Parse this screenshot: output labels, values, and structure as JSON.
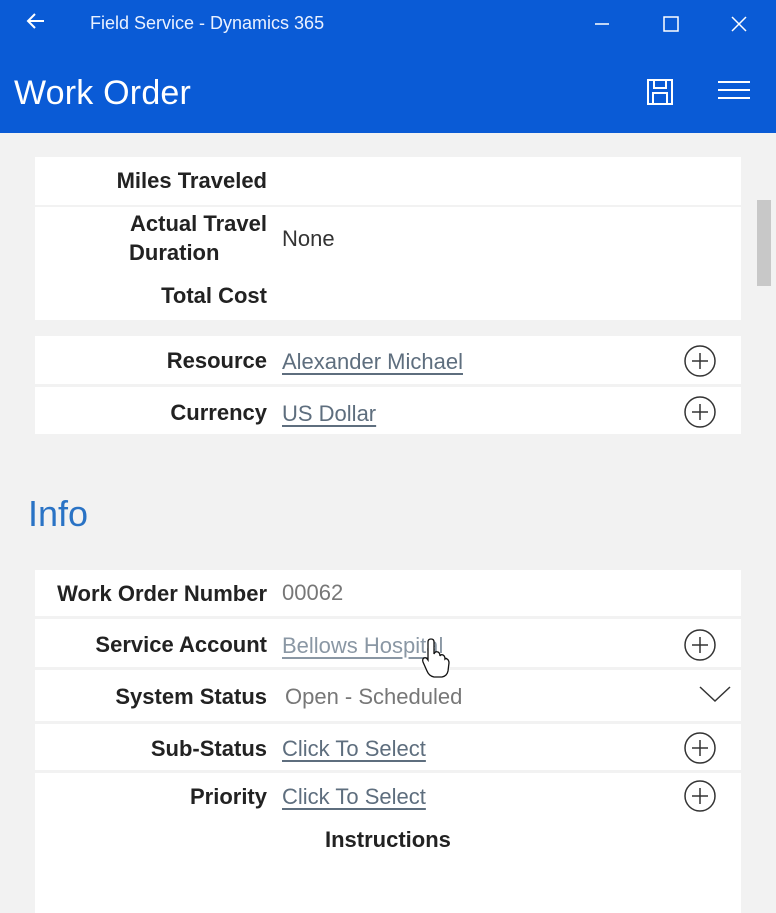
{
  "window": {
    "app_title": "Field Service - Dynamics 365"
  },
  "header": {
    "title": "Work Order"
  },
  "travel": {
    "miles_label": "Miles Traveled",
    "miles_value": "",
    "duration_label_line1": "Actual Travel",
    "duration_label_line2": "Duration",
    "duration_value": "None",
    "total_cost_label": "Total Cost",
    "total_cost_value": ""
  },
  "lookups": {
    "resource_label": "Resource",
    "resource_value": "Alexander Michael",
    "currency_label": "Currency",
    "currency_value": "US Dollar"
  },
  "info": {
    "section_title": "Info",
    "work_order_number_label": "Work Order Number",
    "work_order_number_value": "00062",
    "service_account_label": "Service Account",
    "service_account_value": "Bellows Hospital",
    "system_status_label": "System Status",
    "system_status_value": "Open - Scheduled",
    "sub_status_label": "Sub-Status",
    "sub_status_value": "Click To Select",
    "priority_label": "Priority",
    "priority_value": "Click To Select",
    "instructions_label": "Instructions"
  },
  "icons": {
    "back": "back-arrow-icon",
    "minimize": "minimize-icon",
    "maximize": "maximize-icon",
    "close": "close-icon",
    "save": "save-icon",
    "menu": "hamburger-menu-icon",
    "add": "plus-circle-icon",
    "dropdown": "chevron-down-icon",
    "cursor": "hand-cursor-icon"
  },
  "colors": {
    "brand": "#0a5bd6",
    "section_title": "#2a73c5",
    "link": "#5e6e7e"
  }
}
